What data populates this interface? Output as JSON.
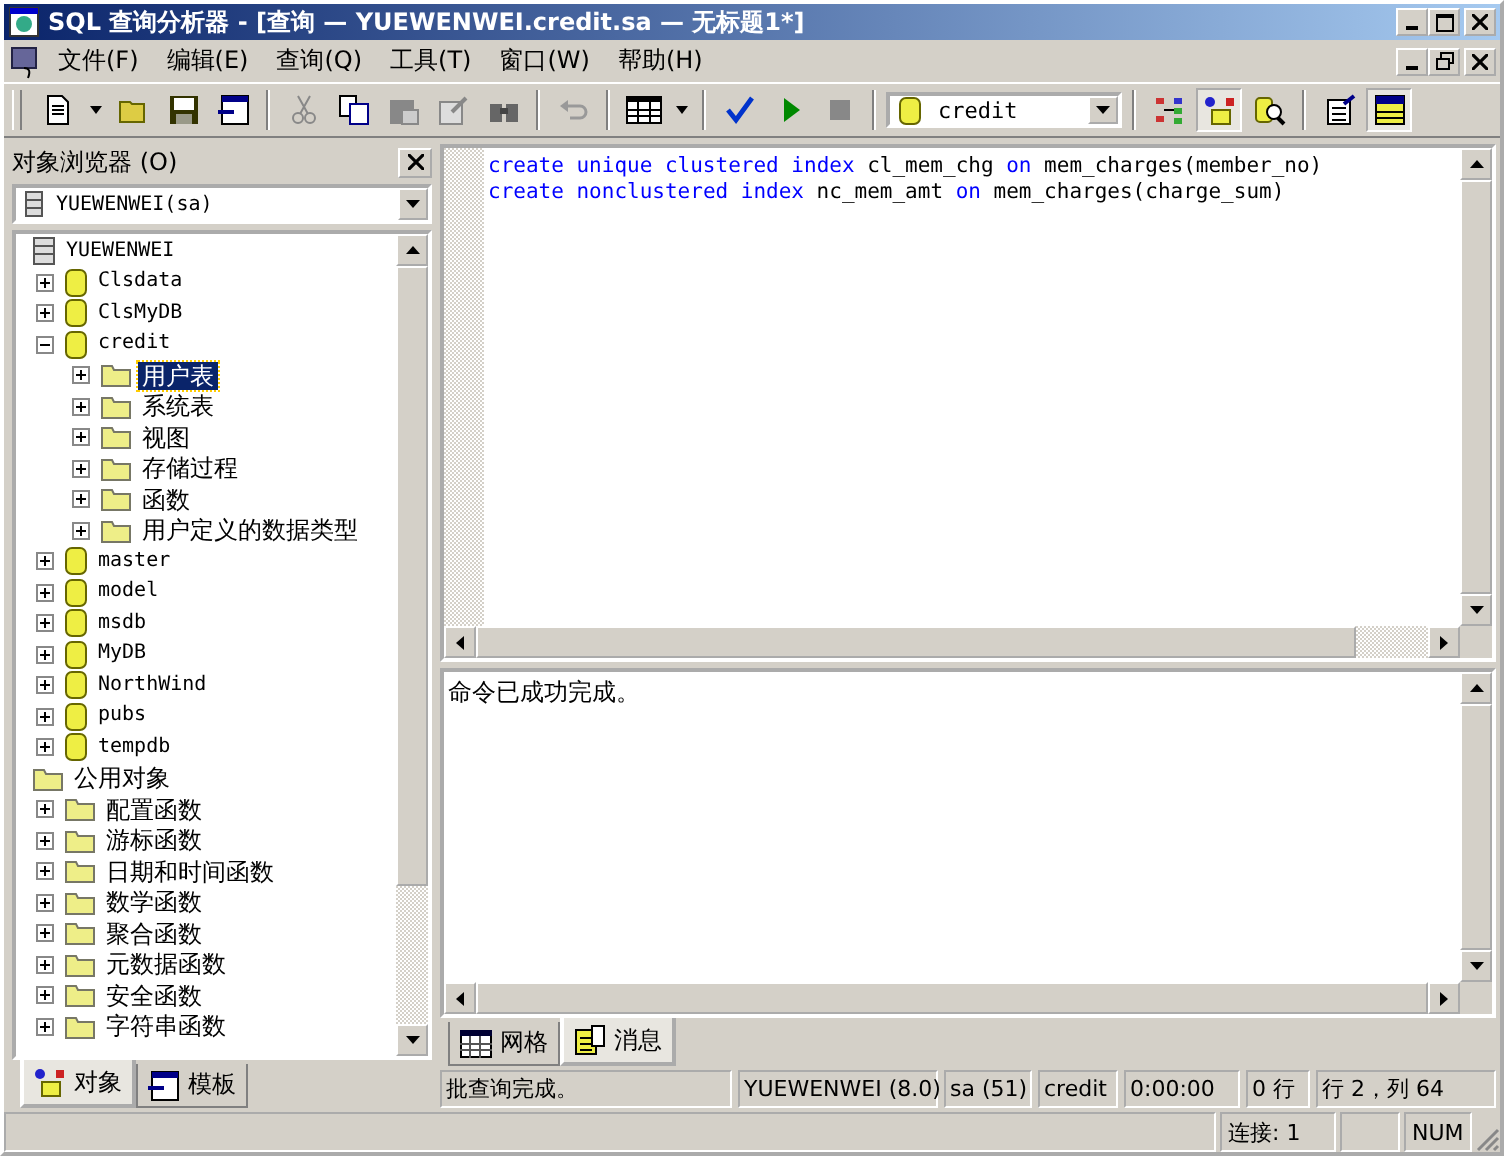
{
  "window": {
    "title": "SQL 查询分析器 - [查询 — YUEWENWEI.credit.sa — 无标题1*]"
  },
  "menu": [
    "文件(F)",
    "编辑(E)",
    "查询(Q)",
    "工具(T)",
    "窗口(W)",
    "帮助(H)"
  ],
  "toolbar": {
    "database": "credit"
  },
  "object_browser": {
    "title": "对象浏览器 (O)",
    "server_select": "YUEWENWEI(sa)",
    "tree": [
      {
        "label": "YUEWENWEI",
        "kind": "server",
        "selected": false,
        "children": [
          {
            "label": "Clsdata",
            "kind": "db",
            "selected": false,
            "expanded": false
          },
          {
            "label": "ClsMyDB",
            "kind": "db",
            "selected": false,
            "expanded": false
          },
          {
            "label": "credit",
            "kind": "db",
            "selected": false,
            "expanded": true,
            "children": [
              {
                "label": "用户表",
                "kind": "folder",
                "selected": true,
                "expanded": false
              },
              {
                "label": "系统表",
                "kind": "folder",
                "selected": false,
                "expanded": false
              },
              {
                "label": "视图",
                "kind": "folder",
                "selected": false,
                "expanded": false
              },
              {
                "label": "存储过程",
                "kind": "folder",
                "selected": false,
                "expanded": false
              },
              {
                "label": "函数",
                "kind": "folder",
                "selected": false,
                "expanded": false
              },
              {
                "label": "用户定义的数据类型",
                "kind": "folder",
                "selected": false,
                "expanded": false
              }
            ]
          },
          {
            "label": "master",
            "kind": "db",
            "selected": false,
            "expanded": false
          },
          {
            "label": "model",
            "kind": "db",
            "selected": false,
            "expanded": false
          },
          {
            "label": "msdb",
            "kind": "db",
            "selected": false,
            "expanded": false
          },
          {
            "label": "MyDB",
            "kind": "db",
            "selected": false,
            "expanded": false
          },
          {
            "label": "NorthWind",
            "kind": "db",
            "selected": false,
            "expanded": false
          },
          {
            "label": "pubs",
            "kind": "db",
            "selected": false,
            "expanded": false
          },
          {
            "label": "tempdb",
            "kind": "db",
            "selected": false,
            "expanded": false
          }
        ]
      },
      {
        "label": "公用对象",
        "kind": "folder",
        "selected": false,
        "children": [
          {
            "label": "配置函数",
            "kind": "folder",
            "selected": false,
            "expanded": false
          },
          {
            "label": "游标函数",
            "kind": "folder",
            "selected": false,
            "expanded": false
          },
          {
            "label": "日期和时间函数",
            "kind": "folder",
            "selected": false,
            "expanded": false
          },
          {
            "label": "数学函数",
            "kind": "folder",
            "selected": false,
            "expanded": false
          },
          {
            "label": "聚合函数",
            "kind": "folder",
            "selected": false,
            "expanded": false
          },
          {
            "label": "元数据函数",
            "kind": "folder",
            "selected": false,
            "expanded": false
          },
          {
            "label": "安全函数",
            "kind": "folder",
            "selected": false,
            "expanded": false
          },
          {
            "label": "字符串函数",
            "kind": "folder",
            "selected": false,
            "expanded": false
          }
        ]
      }
    ],
    "tabs": [
      {
        "label": "对象",
        "selected": true
      },
      {
        "label": "模板",
        "selected": false
      }
    ]
  },
  "editor": {
    "lines": [
      [
        {
          "text": "create",
          "kind": "keyword"
        },
        {
          "text": "unique",
          "kind": "keyword"
        },
        {
          "text": "clustered",
          "kind": "keyword"
        },
        {
          "text": "index",
          "kind": "keyword"
        },
        {
          "text": "cl_mem_chg",
          "kind": "plain"
        },
        {
          "text": "on",
          "kind": "keyword"
        },
        {
          "text": "mem_charges(member_no)",
          "kind": "plain"
        }
      ],
      [
        {
          "text": "create",
          "kind": "keyword"
        },
        {
          "text": "nonclustered",
          "kind": "keyword"
        },
        {
          "text": "index",
          "kind": "keyword"
        },
        {
          "text": "nc_mem_amt",
          "kind": "plain"
        },
        {
          "text": "on",
          "kind": "keyword"
        },
        {
          "text": "mem_charges(charge_sum)",
          "kind": "plain"
        }
      ]
    ]
  },
  "results": {
    "message": "命令已成功完成。",
    "tabs": [
      {
        "label": "网格",
        "selected": false
      },
      {
        "label": "消息",
        "selected": true
      }
    ]
  },
  "query_status": [
    "批查询完成。",
    "YUEWENWEI (8.0)",
    "sa (51)",
    "credit",
    "0:00:00",
    "0 行",
    "行 2，列 64"
  ],
  "status_bar": [
    "连接: 1",
    "NUM"
  ]
}
